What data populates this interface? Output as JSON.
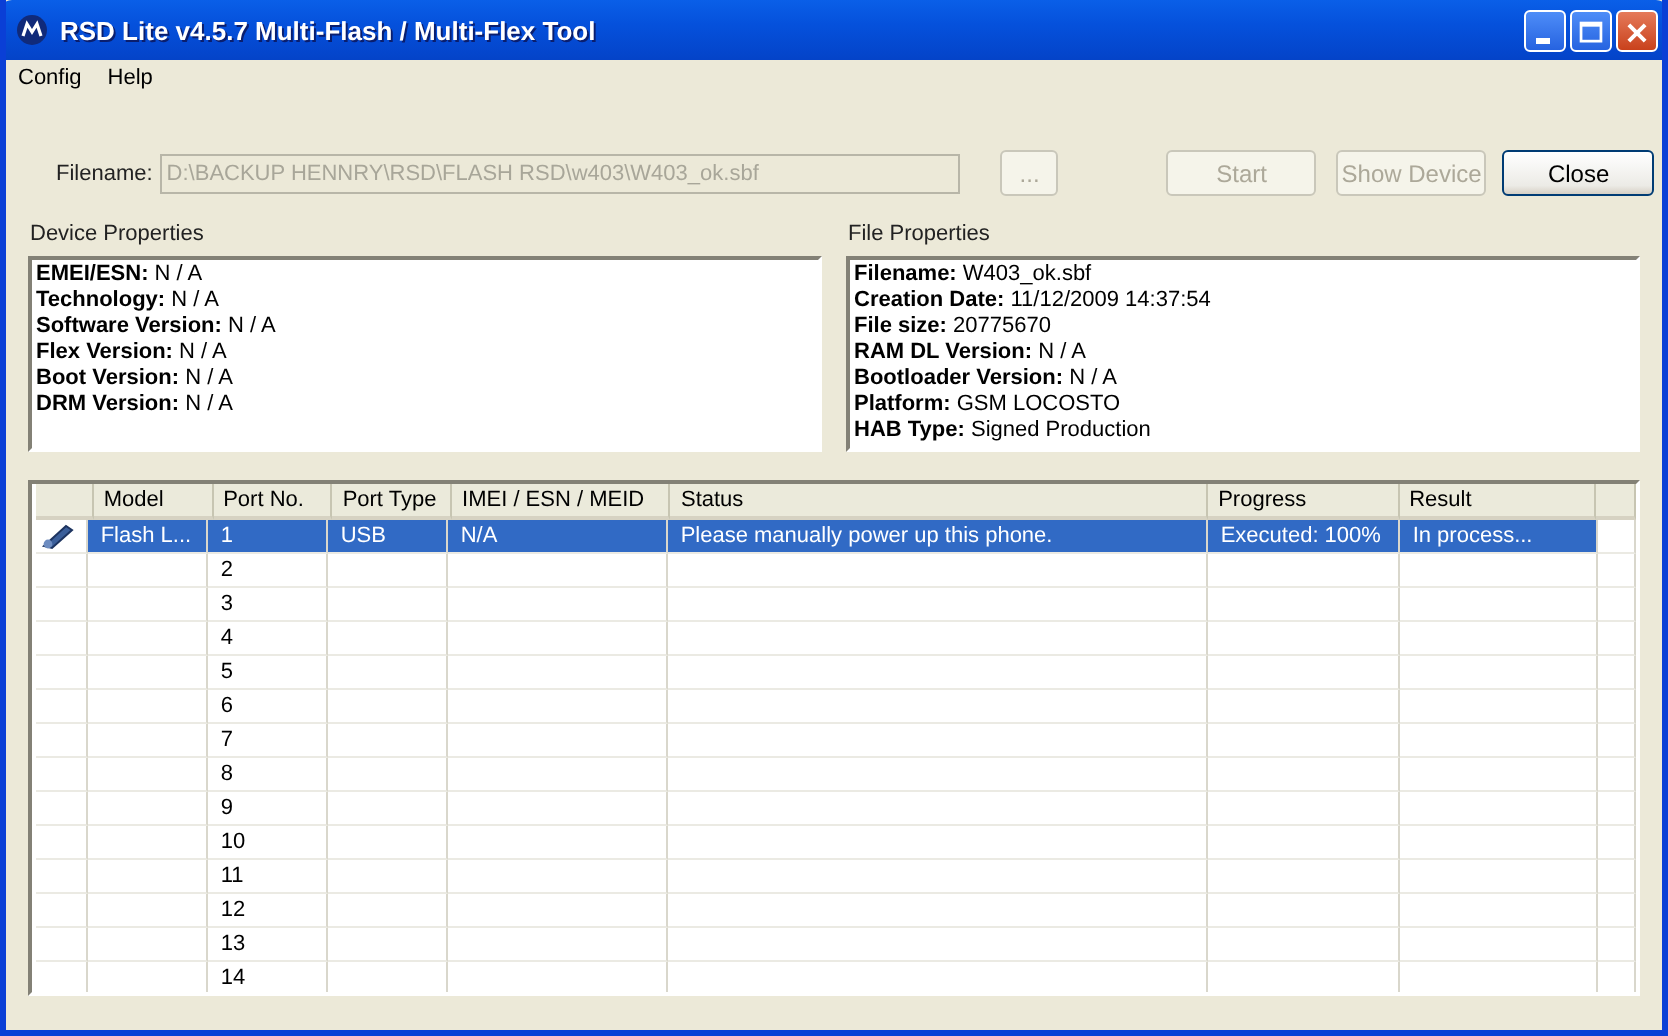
{
  "window": {
    "title": "RSD Lite v4.5.7 Multi-Flash / Multi-Flex Tool"
  },
  "menu": [
    "Config",
    "Help"
  ],
  "filename": {
    "label": "Filename:",
    "value": "D:\\BACKUP HENNRY\\RSD\\FLASH RSD\\w403\\W403_ok.sbf",
    "disabled": true
  },
  "buttons": [
    {
      "label": "...",
      "disabled": true
    },
    {
      "label": "Start",
      "disabled": true
    },
    {
      "label": "Show Device",
      "disabled": true
    },
    {
      "label": "Close",
      "disabled": false
    }
  ],
  "device_properties": {
    "title": "Device Properties",
    "lines": [
      "**EMEI/ESN:** N / A",
      "**Technology:** N / A",
      "**Software Version:** N / A",
      "**Flex Version:** N / A",
      "**Boot Version:** N / A",
      "**DRM Version:** N / A"
    ]
  },
  "file_properties": {
    "title": "File Properties",
    "lines": [
      "**Filename:** W403_ok.sbf",
      "**Creation Date:** 11/12/2009 14:37:54",
      "**File size:** 20775670",
      "**RAM DL Version:** N / A",
      "**Bootloader Version:** N / A",
      "**Platform:** GSM LOCOSTO",
      "**HAB Type:** Signed Production"
    ]
  },
  "table": {
    "columns": [
      "Model",
      "Port No.",
      "Port Type",
      "IMEI / ESN / MEID",
      "Status",
      "Progress",
      "Result"
    ],
    "rows": [
      {
        "device_icon": true,
        "selected": true,
        "cells": [
          "Flash L...",
          "1",
          "USB",
          "N/A",
          "Please manually power up this phone.",
          "Executed: 100%",
          "In process..."
        ]
      },
      {
        "device_icon": false,
        "selected": false,
        "cells": [
          "",
          "2",
          "",
          "",
          "",
          "",
          ""
        ]
      },
      {
        "device_icon": false,
        "selected": false,
        "cells": [
          "",
          "3",
          "",
          "",
          "",
          "",
          ""
        ]
      },
      {
        "device_icon": false,
        "selected": false,
        "cells": [
          "",
          "4",
          "",
          "",
          "",
          "",
          ""
        ]
      },
      {
        "device_icon": false,
        "selected": false,
        "cells": [
          "",
          "5",
          "",
          "",
          "",
          "",
          ""
        ]
      },
      {
        "device_icon": false,
        "selected": false,
        "cells": [
          "",
          "6",
          "",
          "",
          "",
          "",
          ""
        ]
      },
      {
        "device_icon": false,
        "selected": false,
        "cells": [
          "",
          "7",
          "",
          "",
          "",
          "",
          ""
        ]
      },
      {
        "device_icon": false,
        "selected": false,
        "cells": [
          "",
          "8",
          "",
          "",
          "",
          "",
          ""
        ]
      },
      {
        "device_icon": false,
        "selected": false,
        "cells": [
          "",
          "9",
          "",
          "",
          "",
          "",
          ""
        ]
      },
      {
        "device_icon": false,
        "selected": false,
        "cells": [
          "",
          "10",
          "",
          "",
          "",
          "",
          ""
        ]
      },
      {
        "device_icon": false,
        "selected": false,
        "cells": [
          "",
          "11",
          "",
          "",
          "",
          "",
          ""
        ]
      },
      {
        "device_icon": false,
        "selected": false,
        "cells": [
          "",
          "12",
          "",
          "",
          "",
          "",
          ""
        ]
      },
      {
        "device_icon": false,
        "selected": false,
        "cells": [
          "",
          "13",
          "",
          "",
          "",
          "",
          ""
        ]
      },
      {
        "device_icon": false,
        "selected": false,
        "cells": [
          "",
          "14",
          "",
          "",
          "",
          "",
          ""
        ]
      }
    ]
  }
}
